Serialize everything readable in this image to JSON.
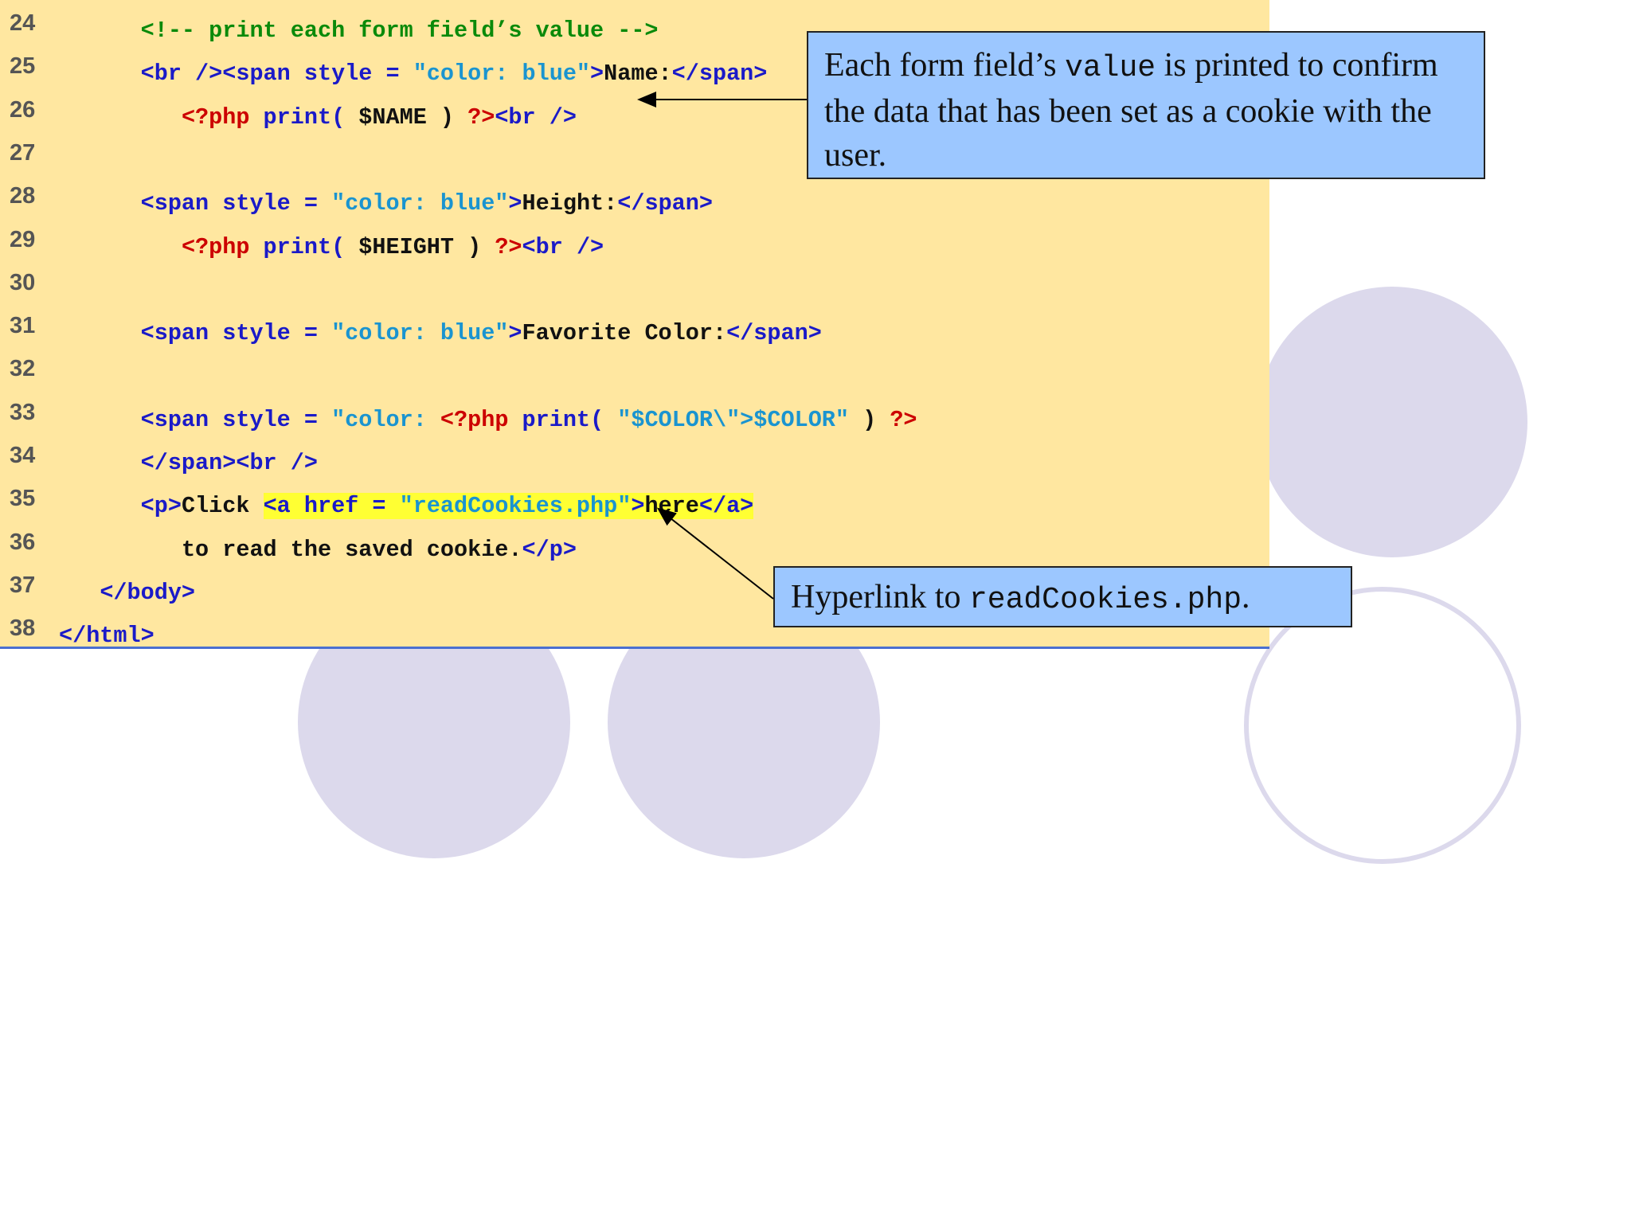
{
  "code_lines": [
    {
      "num": "24",
      "tokens": [
        {
          "t": "      "
        },
        {
          "t": "<!-- print each form field’s value -->",
          "c": "c-green"
        }
      ]
    },
    {
      "num": "25",
      "tokens": [
        {
          "t": "      "
        },
        {
          "t": "<br /><span style = ",
          "c": "c-blue"
        },
        {
          "t": "\"color: blue\"",
          "c": "c-cyan"
        },
        {
          "t": ">",
          "c": "c-blue"
        },
        {
          "t": "Name:",
          "c": "c-black"
        },
        {
          "t": "</span>",
          "c": "c-blue"
        }
      ]
    },
    {
      "num": "26",
      "tokens": [
        {
          "t": "         "
        },
        {
          "t": "<?php",
          "c": "c-red"
        },
        {
          "t": " print( ",
          "c": "c-blue"
        },
        {
          "t": "$NAME",
          "c": "c-black"
        },
        {
          "t": " ) ",
          "c": "c-black"
        },
        {
          "t": "?>",
          "c": "c-red"
        },
        {
          "t": "<br />",
          "c": "c-blue"
        }
      ]
    },
    {
      "num": "27",
      "tokens": []
    },
    {
      "num": "28",
      "tokens": [
        {
          "t": "      "
        },
        {
          "t": "<span style = ",
          "c": "c-blue"
        },
        {
          "t": "\"color: blue\"",
          "c": "c-cyan"
        },
        {
          "t": ">",
          "c": "c-blue"
        },
        {
          "t": "Height:",
          "c": "c-black"
        },
        {
          "t": "</span>",
          "c": "c-blue"
        }
      ]
    },
    {
      "num": "29",
      "tokens": [
        {
          "t": "         "
        },
        {
          "t": "<?php",
          "c": "c-red"
        },
        {
          "t": " print( ",
          "c": "c-blue"
        },
        {
          "t": "$HEIGHT",
          "c": "c-black"
        },
        {
          "t": " ) ",
          "c": "c-black"
        },
        {
          "t": "?>",
          "c": "c-red"
        },
        {
          "t": "<br />",
          "c": "c-blue"
        }
      ]
    },
    {
      "num": "30",
      "tokens": []
    },
    {
      "num": "31",
      "tokens": [
        {
          "t": "      "
        },
        {
          "t": "<span style = ",
          "c": "c-blue"
        },
        {
          "t": "\"color: blue\"",
          "c": "c-cyan"
        },
        {
          "t": ">",
          "c": "c-blue"
        },
        {
          "t": "Favorite Color:",
          "c": "c-black"
        },
        {
          "t": "</span>",
          "c": "c-blue"
        }
      ]
    },
    {
      "num": "32",
      "tokens": []
    },
    {
      "num": "33",
      "tokens": [
        {
          "t": "      "
        },
        {
          "t": "<span style = ",
          "c": "c-blue"
        },
        {
          "t": "\"color: ",
          "c": "c-cyan"
        },
        {
          "t": "<?php",
          "c": "c-red"
        },
        {
          "t": " print( ",
          "c": "c-blue"
        },
        {
          "t": "\"$COLOR\\\">$COLOR\"",
          "c": "c-cyan"
        },
        {
          "t": " ) ",
          "c": "c-black"
        },
        {
          "t": "?>",
          "c": "c-red"
        }
      ]
    },
    {
      "num": "34",
      "tokens": [
        {
          "t": "      "
        },
        {
          "t": "</span><br />",
          "c": "c-blue"
        }
      ]
    },
    {
      "num": "35",
      "tokens": [
        {
          "t": "      "
        },
        {
          "t": "<p>",
          "c": "c-blue"
        },
        {
          "t": "Click ",
          "c": "c-black"
        },
        {
          "t": "<a href = ",
          "c": "c-blue",
          "hl": true
        },
        {
          "t": "\"readCookies.php\"",
          "c": "c-cyan",
          "hl": true
        },
        {
          "t": ">",
          "c": "c-blue",
          "hl": true
        },
        {
          "t": "here",
          "c": "c-black",
          "hl": true
        },
        {
          "t": "</a>",
          "c": "c-blue",
          "hl": true
        }
      ]
    },
    {
      "num": "36",
      "tokens": [
        {
          "t": "         "
        },
        {
          "t": "to read the saved cookie.",
          "c": "c-black"
        },
        {
          "t": "</p>",
          "c": "c-blue"
        }
      ]
    },
    {
      "num": "37",
      "tokens": [
        {
          "t": "   "
        },
        {
          "t": "</body>",
          "c": "c-blue"
        }
      ]
    },
    {
      "num": "38",
      "tokens": [
        {
          "t": "</html>",
          "c": "c-blue"
        }
      ]
    }
  ],
  "callouts": {
    "field_value": {
      "pre": "Each form field’s ",
      "mono": "value",
      "post": " is printed to confirm the data that has been set as a cookie with the user."
    },
    "hyperlink": {
      "pre": "Hyperlink to ",
      "mono": "readCookies.php",
      "post": "."
    }
  }
}
